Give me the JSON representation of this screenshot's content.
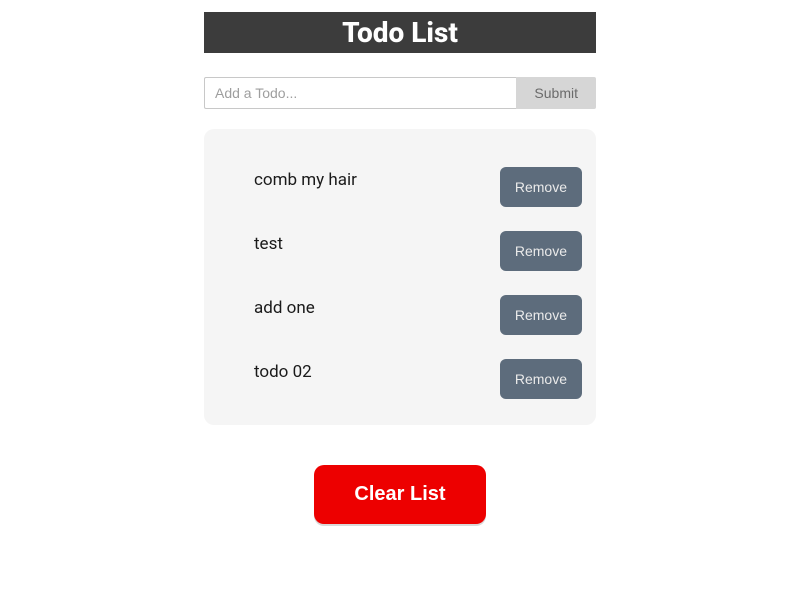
{
  "header": {
    "title": "Todo List"
  },
  "form": {
    "input_placeholder": "Add a Todo...",
    "submit_label": "Submit"
  },
  "todos": [
    {
      "text": "comb my hair",
      "remove_label": "Remove"
    },
    {
      "text": "test",
      "remove_label": "Remove"
    },
    {
      "text": "add one",
      "remove_label": "Remove"
    },
    {
      "text": "todo 02",
      "remove_label": "Remove"
    }
  ],
  "clear": {
    "label": "Clear List"
  }
}
